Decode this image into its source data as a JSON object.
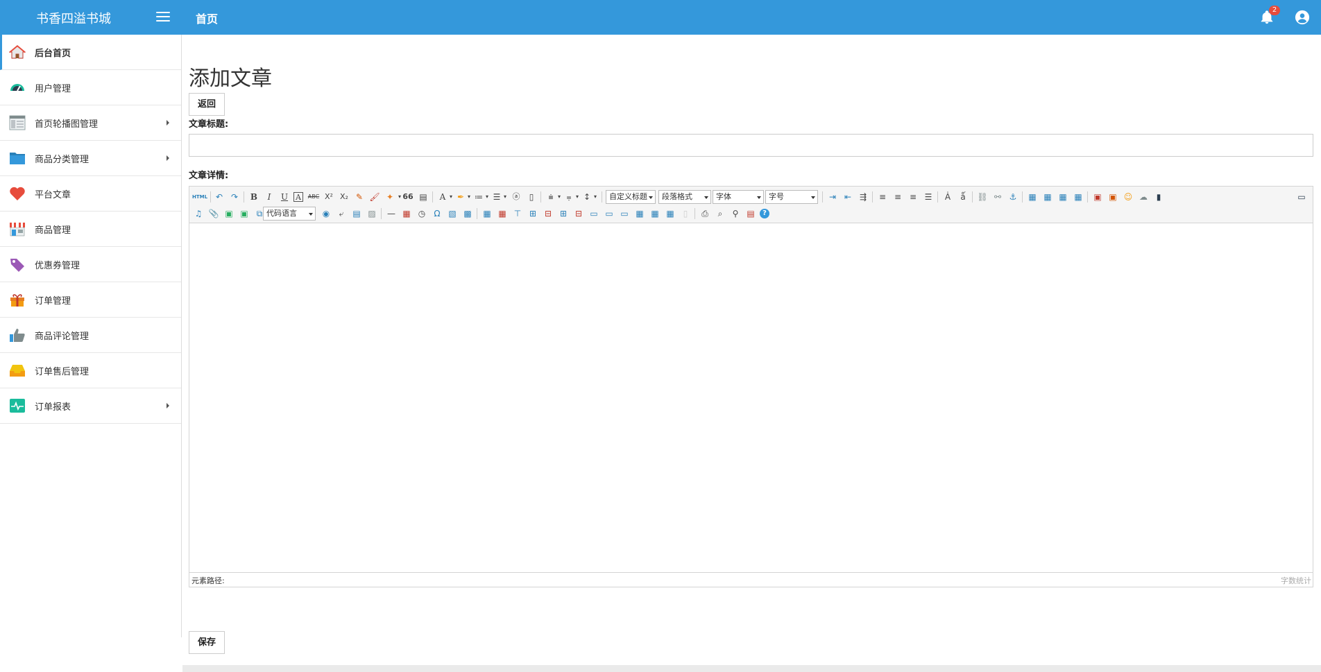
{
  "app": {
    "title": "书香四溢书城"
  },
  "header": {
    "home_label": "首页",
    "notification_count": "2",
    "colors": {
      "bar": "#3498db",
      "badge": "#e74c3c"
    }
  },
  "sidebar": {
    "items": [
      {
        "label": "后台首页",
        "icon": "home-icon",
        "active": true
      },
      {
        "label": "用户管理",
        "icon": "dashboard-icon"
      },
      {
        "label": "首页轮播图管理",
        "icon": "layout-icon",
        "has_submenu": true
      },
      {
        "label": "商品分类管理",
        "icon": "folder-icon",
        "has_submenu": true
      },
      {
        "label": "平台文章",
        "icon": "heart-icon"
      },
      {
        "label": "商品管理",
        "icon": "shop-icon"
      },
      {
        "label": "优惠券管理",
        "icon": "tag-icon"
      },
      {
        "label": "订单管理",
        "icon": "gift-icon"
      },
      {
        "label": "商品评论管理",
        "icon": "thumbs-up-icon"
      },
      {
        "label": "订单售后管理",
        "icon": "inbox-icon"
      },
      {
        "label": "订单报表",
        "icon": "pulse-chart-icon",
        "has_submenu": true
      }
    ]
  },
  "main": {
    "heading": "添加文章",
    "back_label": "返回",
    "title_label": "文章标题:",
    "title_value": "",
    "detail_label": "文章详情:",
    "save_label": "保存"
  },
  "editor": {
    "toolbar": {
      "html_label": "HTML",
      "custom_title": "自定义标题",
      "paragraph_format": "段落格式",
      "font_family": "字体",
      "font_size": "字号",
      "code_language": "代码语言",
      "bold": "B",
      "italic": "I",
      "underline": "U",
      "font_border": "A",
      "strike": "ABC",
      "sup": "X²",
      "sub": "X₂",
      "quote": "66",
      "fore_color": "A",
      "omega": "Ω",
      "help": "?"
    },
    "status": {
      "path_label": "元素路径:",
      "word_count_label": "字数统计"
    }
  }
}
